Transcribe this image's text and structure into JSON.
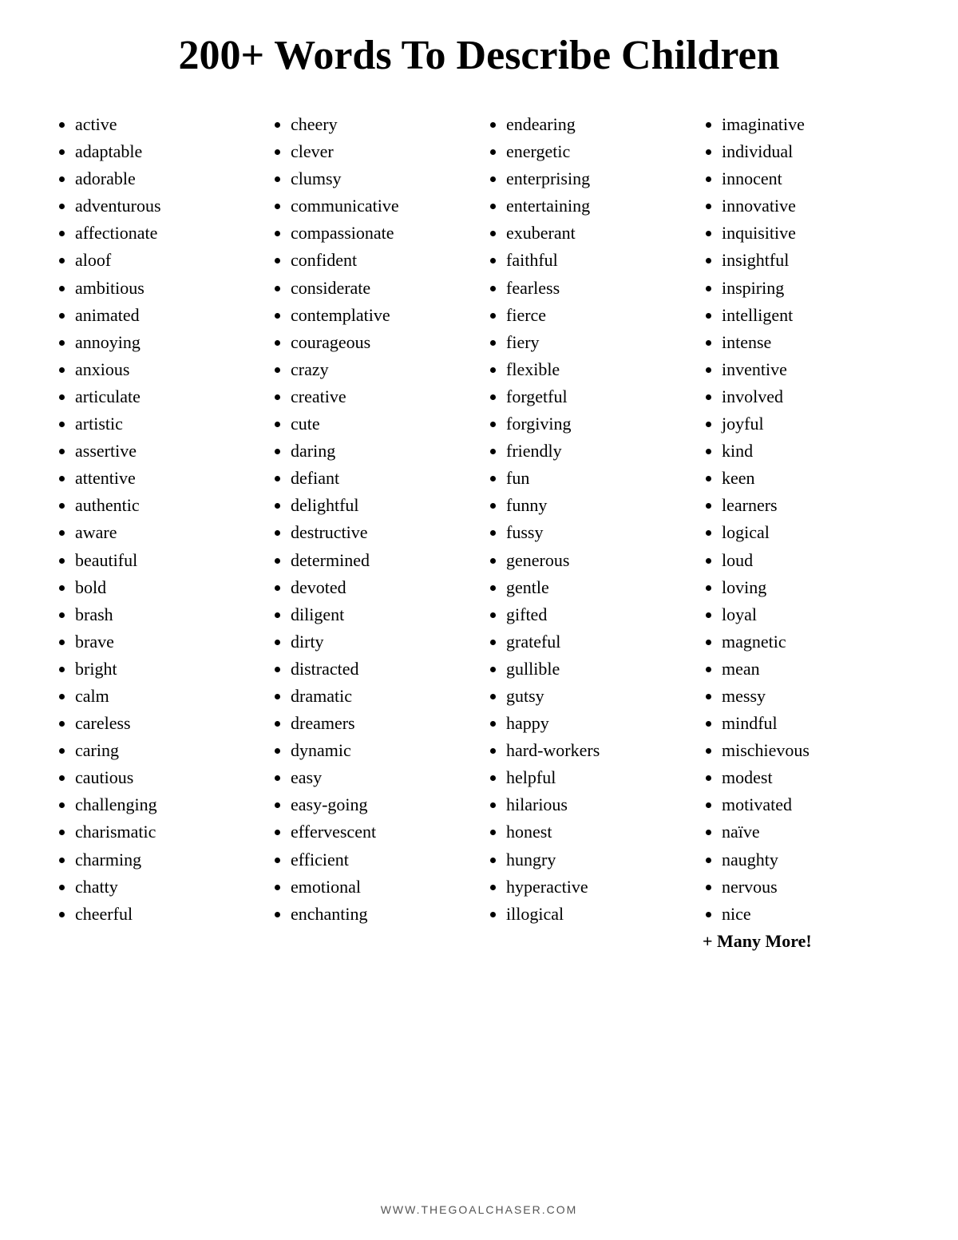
{
  "title": "200+ Words To Describe Children",
  "columns": [
    {
      "id": "col1",
      "words": [
        "active",
        "adaptable",
        "adorable",
        "adventurous",
        "affectionate",
        "aloof",
        "ambitious",
        "animated",
        "annoying",
        "anxious",
        "articulate",
        "artistic",
        "assertive",
        "attentive",
        "authentic",
        "aware",
        "beautiful",
        "bold",
        "brash",
        "brave",
        "bright",
        "calm",
        "careless",
        "caring",
        "cautious",
        "challenging",
        "charismatic",
        "charming",
        "chatty",
        "cheerful"
      ]
    },
    {
      "id": "col2",
      "words": [
        "cheery",
        "clever",
        "clumsy",
        "communicative",
        "compassionate",
        "confident",
        "considerate",
        "contemplative",
        "courageous",
        "crazy",
        "creative",
        "cute",
        "daring",
        "defiant",
        "delightful",
        "destructive",
        "determined",
        "devoted",
        "diligent",
        "dirty",
        "distracted",
        "dramatic",
        "dreamers",
        "dynamic",
        "easy",
        "easy-going",
        "effervescent",
        "efficient",
        "emotional",
        "enchanting"
      ]
    },
    {
      "id": "col3",
      "words": [
        "endearing",
        "energetic",
        "enterprising",
        "entertaining",
        "exuberant",
        "faithful",
        "fearless",
        "fierce",
        "fiery",
        "flexible",
        "forgetful",
        "forgiving",
        "friendly",
        "fun",
        "funny",
        "fussy",
        "generous",
        "gentle",
        "gifted",
        "grateful",
        "gullible",
        "gutsy",
        "happy",
        "hard-workers",
        "helpful",
        "hilarious",
        "honest",
        "hungry",
        "hyperactive",
        "illogical"
      ]
    },
    {
      "id": "col4",
      "words": [
        "imaginative",
        "individual",
        "innocent",
        "innovative",
        "inquisitive",
        "insightful",
        "inspiring",
        "intelligent",
        "intense",
        "inventive",
        "involved",
        "joyful",
        "kind",
        "keen",
        "learners",
        "logical",
        "loud",
        "loving",
        "loyal",
        "magnetic",
        "mean",
        "messy",
        "mindful",
        "mischievous",
        "modest",
        "motivated",
        "naïve",
        "naughty",
        "nervous",
        "nice"
      ],
      "extra": "+ Many More!"
    }
  ],
  "footer": "WWW.THEGOALCHASER.COM"
}
